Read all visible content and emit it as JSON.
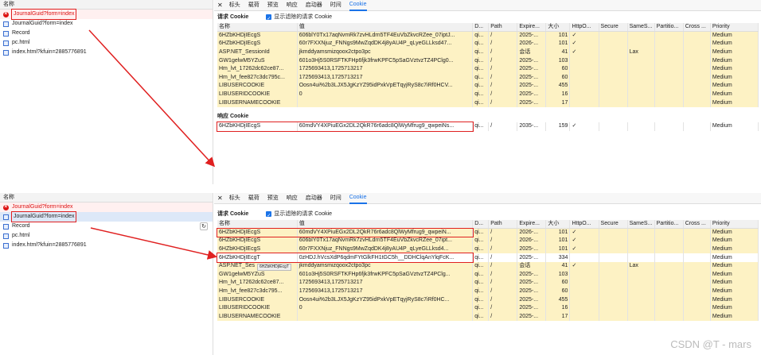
{
  "left": {
    "header": "名称",
    "items": [
      {
        "label": "JournalGuid?form=index",
        "type": "error"
      },
      {
        "label": "JournalGuid?form=index",
        "type": "doc"
      },
      {
        "label": "Record",
        "type": "doc"
      },
      {
        "label": "pc.html",
        "type": "doc"
      },
      {
        "label": "index.html?kfuin=2885776891",
        "type": "doc"
      }
    ]
  },
  "tabs": [
    "标头",
    "载荷",
    "预览",
    "响应",
    "启动器",
    "时间",
    "Cookie"
  ],
  "close_symbol": "✕",
  "request_cookie_title": "请求 Cookie",
  "show_filtered_label": "显示滤除的请求 Cookie",
  "response_cookie_title": "响应 Cookie",
  "columns": [
    "名称",
    "值",
    "D...",
    "Path",
    "Expire...",
    "大小",
    "HttpO...",
    "Secure",
    "SameS...",
    "Partitio...",
    "Cross ...",
    "Priority"
  ],
  "columns2": [
    "名称",
    "值",
    "D...",
    "Path",
    "Expire...",
    "大小",
    "HttpO...",
    "Secure",
    "SameS...",
    "Partitio...",
    "Cross ...",
    "Priority"
  ],
  "panel1_request": [
    [
      "6HZbKHDjIEcgS",
      "606blY0Tx17aqNvmRk7zvHLdrn5TF4EuVbZkvcRZee_07iptJ...",
      "qi...",
      "/",
      "2025-...",
      "101",
      "✓",
      "",
      "",
      "",
      "",
      "Medium"
    ],
    [
      "6HZbKHDjIEcgS",
      "60r7FXXNjuz_FNNgs9MwZqdDK4j8yAU4P_qLyeGLLksd47...",
      "qi...",
      "/",
      "2026-...",
      "101",
      "✓",
      "",
      "",
      "",
      "",
      "Medium"
    ],
    [
      "ASP.NET_SessionId",
      "jkmddyamsmizqoox2ctpo3pc",
      "qi...",
      "/",
      "会话",
      "41",
      "✓",
      "",
      "Lax",
      "",
      "",
      "Medium"
    ],
    [
      "GW1gelwM5YZuS",
      "601o3Hj5S0RSFTKFHp6fjk3frwKPFC5pSaGVztvzTZ4PClg0...",
      "qi...",
      "/",
      "2025-...",
      "103",
      "",
      "",
      "",
      "",
      "",
      "Medium"
    ],
    [
      "Hm_lvt_17262dc62ce87...",
      "1725693413,1725713217",
      "qi...",
      "/",
      "2025-...",
      "60",
      "",
      "",
      "",
      "",
      "",
      "Medium"
    ],
    [
      "Hm_lvt_fee827c3dc795c...",
      "1725693413,1725713217",
      "qi...",
      "/",
      "2025-...",
      "60",
      "",
      "",
      "",
      "",
      "",
      "Medium"
    ],
    [
      "LIBUSERCOOKIE",
      "Oosn4ui%2b3LJX5JgKzYZ95idPxkVpETqyjRyS8c7iRf0HCV...",
      "qi...",
      "/",
      "2025-...",
      "455",
      "",
      "",
      "",
      "",
      "",
      "Medium"
    ],
    [
      "LIBUSERIDCOOKIE",
      "0",
      "qi...",
      "/",
      "2025-...",
      "16",
      "",
      "",
      "",
      "",
      "",
      "Medium"
    ],
    [
      "LIBUSERNAMECOOKIE",
      "",
      "qi...",
      "/",
      "2025-...",
      "17",
      "",
      "",
      "",
      "",
      "",
      "Medium"
    ]
  ],
  "panel1_response": [
    [
      "6HZbKHDjIEcgS",
      "60mdVY4XPiuEGx2DL2QkR76r6adc8QlWyMfrug9_qwpeiNs...",
      "qi...",
      "/",
      "2035-...",
      "159",
      "✓",
      "",
      "",
      "",
      "",
      "Medium"
    ]
  ],
  "panel2_request": [
    [
      "6HZbKHDjIEcgS",
      "60mdVY4XPiuEGx2DL2QkR76r6adc8QlWyMfrug9_qwpeiN...",
      "qi...",
      "/",
      "2026-...",
      "101",
      "✓",
      "",
      "",
      "",
      "",
      "Medium"
    ],
    [
      "6HZbKHDjIEcgS",
      "606blY0Tx17aqNvmRk7zvHLdrn5TF4EuVbZkvcRZee_07ipt...",
      "qi...",
      "/",
      "2026-...",
      "101",
      "✓",
      "",
      "",
      "",
      "",
      "Medium"
    ],
    [
      "6HZbKHDjIEcgS",
      "60r7FXXNjuz_FNNgs9MwZqdDK4j8yAU4P_qLyeGLLksd4...",
      "qi...",
      "/",
      "2025-...",
      "101",
      "✓",
      "",
      "",
      "",
      "",
      "Medium"
    ],
    [
      "6HZbKHDjIEcgT",
      "0zHDJ.hVcsXdP6qdmFYtGlkFH1tGC5h__DDHClqAnYlqFcK...",
      "qi...",
      "/",
      "2025-...",
      "334",
      "",
      "",
      "",
      "",
      "",
      "Medium"
    ],
    [
      "ASP.NET_Ses",
      "jkmddyamsmizqoox2ctpo3pc",
      "qi...",
      "/",
      "会话",
      "41",
      "✓",
      "",
      "Lax",
      "",
      "",
      "Medium"
    ],
    [
      "GW1gelwM5YZuS",
      "601o3Hj5S0RSFTKFHp6fjk3frwKPFC5pSaGVztvzTZ4PClg...",
      "qi...",
      "/",
      "2025-...",
      "103",
      "",
      "",
      "",
      "",
      "",
      "Medium"
    ],
    [
      "Hm_lvt_17262dc62ce87...",
      "1725693413,1725713217",
      "qi...",
      "/",
      "2025-...",
      "60",
      "",
      "",
      "",
      "",
      "",
      "Medium"
    ],
    [
      "Hm_lvt_fee827c3dc795...",
      "1725693413,1725713217",
      "qi...",
      "/",
      "2025-...",
      "60",
      "",
      "",
      "",
      "",
      "",
      "Medium"
    ],
    [
      "LIBUSERCOOKIE",
      "Oosn4ui%2b3LJX5JgKzYZ95idPxkVpETqyjRyS8c7iRf0HC...",
      "qi...",
      "/",
      "2025-...",
      "455",
      "",
      "",
      "",
      "",
      "",
      "Medium"
    ],
    [
      "LIBUSERIDCOOKIE",
      "0",
      "qi...",
      "/",
      "2025-...",
      "16",
      "",
      "",
      "",
      "",
      "",
      "Medium"
    ],
    [
      "LIBUSERNAMECOOKIE",
      "",
      "qi...",
      "/",
      "2025-...",
      "17",
      "",
      "",
      "",
      "",
      "",
      "Medium"
    ]
  ],
  "tooltip": "6HZbKHDjIEcgT",
  "watermark": "CSDN @T - mars",
  "colors": {
    "highlight": "#e02020",
    "warning_row": "#fdf2c4",
    "accent": "#1a73e8",
    "error": "#dd1111"
  }
}
